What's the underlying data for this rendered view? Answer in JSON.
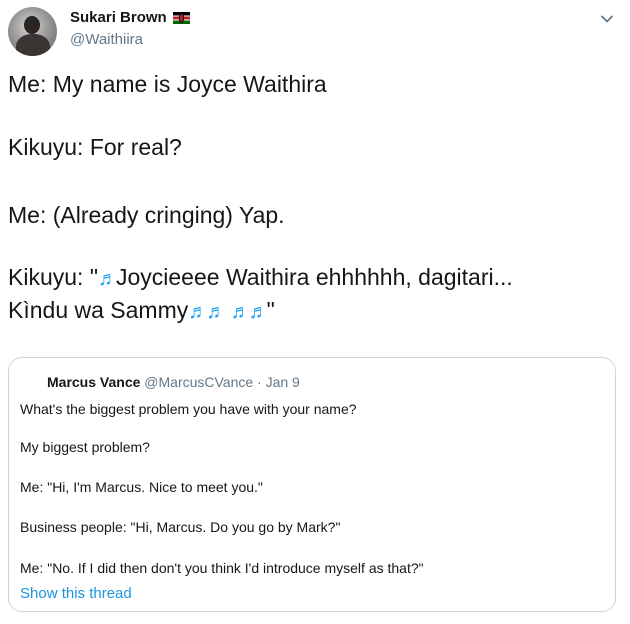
{
  "author": {
    "display_name": "Sukari Brown",
    "handle": "@Waithiira",
    "flag_icon": "kenya-flag-icon"
  },
  "tweet": {
    "line1": "Me: My name is Joyce Waithira",
    "line2": "Kikuyu: For real?",
    "line3": "Me: (Already cringing) Yap.",
    "line4_pre": "Kikuyu: \"",
    "line4_post": "Joycieeee Waithira ehhhhhh, dagitari...",
    "line5_pre": "Kìndu wa Sammy",
    "line5_post": "\"",
    "music_glyph": "♬"
  },
  "quoted": {
    "display_name": "Marcus Vance",
    "meta": "@MarcusCVance · Jan 9",
    "lines": [
      "What's the biggest problem you have with your name?",
      "My biggest problem?",
      "Me: \"Hi, I'm Marcus. Nice to meet you.\"",
      "Business people: \"Hi, Marcus. Do you go by Mark?\"",
      "Me: \"No. If I did then don't you think I'd introduce myself as that?\""
    ],
    "show_thread": "Show this thread"
  },
  "colors": {
    "accent": "#1da1f2",
    "link": "#1b95e0",
    "secondary_text": "#657786",
    "border": "#ccd6dd"
  }
}
